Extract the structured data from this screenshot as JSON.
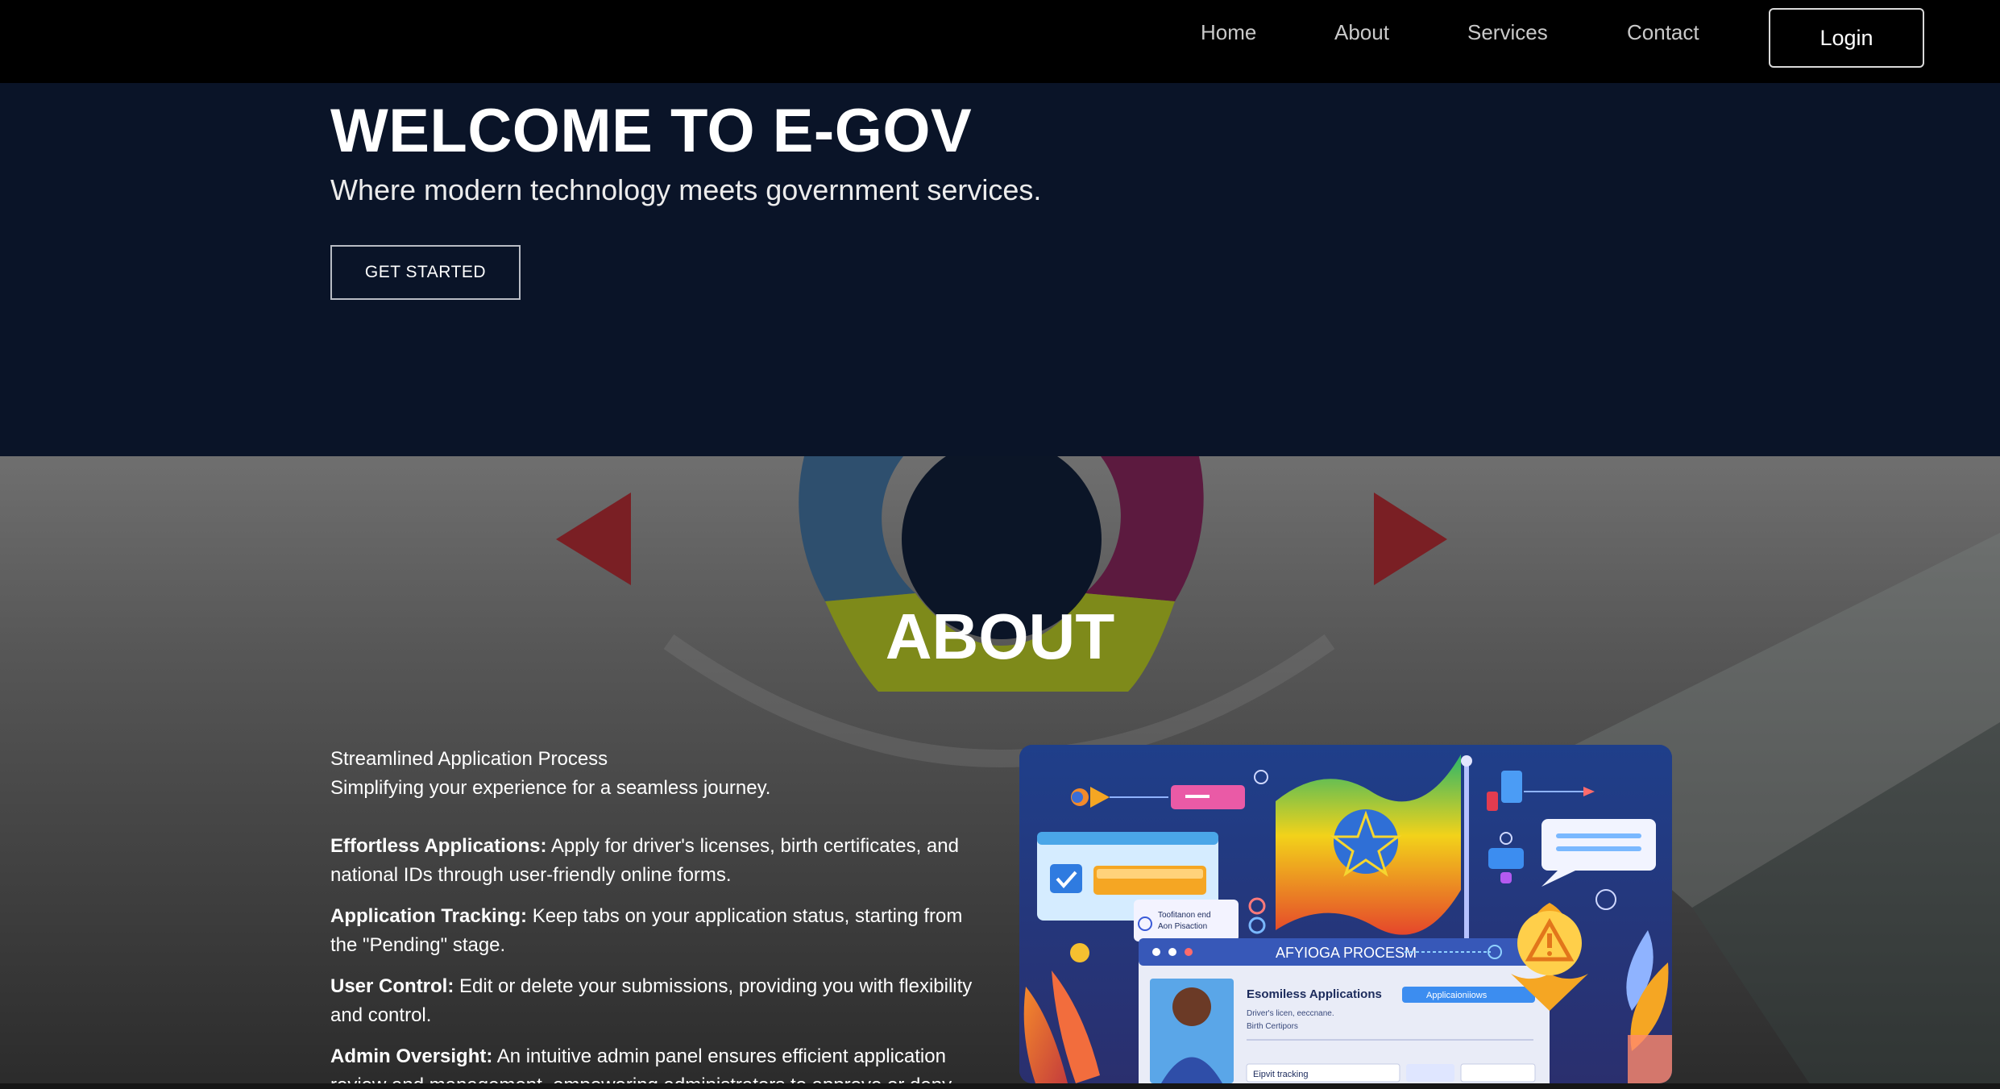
{
  "nav": {
    "links": [
      "Home",
      "About",
      "Services",
      "Contact"
    ],
    "login_label": "Login"
  },
  "hero": {
    "title": "WELCOME TO E-GOV",
    "subtitle": "Where modern technology meets government services.",
    "cta_label": "GET STARTED"
  },
  "about": {
    "title": "ABOUT",
    "intro_heading": "Streamlined Application Process",
    "intro_subtitle": "Simplifying your experience for a seamless journey.",
    "features": [
      {
        "title": "Effortless Applications:",
        "text": "Apply for driver's licenses, birth certificates, and national IDs through user-friendly online forms."
      },
      {
        "title": "Application Tracking:",
        "text": "Keep tabs on your application status, starting from the \"Pending\" stage."
      },
      {
        "title": "User Control:",
        "text": "Edit or delete your submissions, providing you with flexibility and control."
      },
      {
        "title": "Admin Oversight:",
        "text": "An intuitive admin panel ensures efficient application review and management, empowering administrators to approve or deny."
      }
    ],
    "illustration": {
      "banner_label": "AFYIOGA PROCESM",
      "card_title": "Esomiless Applications",
      "card_line_1": "Driver's licen, eeccnane.",
      "card_line_2": "Birth Certipors",
      "card_button": "Applicaioniiows",
      "card_track": "Eipvit tracking",
      "tooltip_line_1": "Toofitanon end",
      "tooltip_line_2": "Aon Pisaction"
    }
  },
  "colors": {
    "navbar_bg": "#000000",
    "hero_bg": "#0a1428",
    "accent_red": "#7a1f24",
    "ring_blue": "#2e4f6e",
    "ring_purple": "#5c1a3f",
    "ring_olive": "#7e8a1a"
  },
  "icons": [
    "triangle-left-icon",
    "triangle-right-icon",
    "ethiopia-flag-icon",
    "warning-icon",
    "checkbox-icon",
    "chat-bubble-icon"
  ]
}
